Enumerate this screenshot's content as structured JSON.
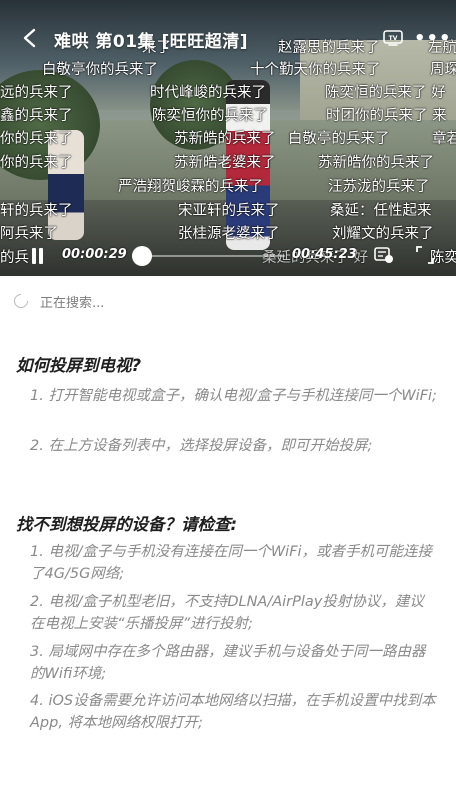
{
  "player": {
    "title": "难哄 第01集 [旺旺超清]",
    "time_current": "00:00:29",
    "time_total": "00:45:23",
    "progress": 0.0107,
    "danmaku": [
      "来了",
      "赵露思的兵来了",
      "左航",
      "白敬亭你的兵来了",
      "十个勤天你的兵来了",
      "周琛",
      "远的兵来了",
      "时代峰峻的兵来了",
      "陈奕恒的兵来了 好",
      "鑫的兵来了",
      "陈奕恒你的兵来了",
      "时团你的兵来了 来",
      "你的兵来了",
      "苏新皓的兵来了",
      "白敬亭的兵来了",
      "章若",
      "你的兵来了",
      "苏新皓老婆来了",
      "苏新皓你的兵来了",
      "严浩翔贺峻霖的兵来了",
      "汪苏泷的兵来了",
      "轩的兵来了",
      "宋亚轩的兵来了",
      "桑延：任性起来",
      "阿兵来了",
      "张桂源老婆来了",
      "刘耀文的兵来了",
      "的兵",
      "桑延的兵来了 好",
      "陈奕"
    ]
  },
  "cast": {
    "searching_label": "正在搜索...",
    "how_to_title": "如何投屏到电视?",
    "how_to_steps": [
      "1. 打开智能电视或盒子，确认电视/盒子与手机连接同一个WiFi;",
      "2. 在上方设备列表中，选择投屏设备，即可开始投屏;"
    ],
    "troubleshoot_title": "找不到想投屏的设备？请检查:",
    "troubleshoot_steps": [
      "1. 电视/盒子与手机没有连接在同一个WiFi，或者手机可能连接了4G/5G网络;",
      "2. 电视/盒子机型老旧，不支持DLNA/AirPlay投射协议，建议在电视上安装“乐播投屏”进行投射;",
      "3. 局域网中存在多个路由器，建议手机与设备处于同一路由器的Wifi环境;",
      "4. iOS设备需要允许访问本地网络以扫描，在手机设置中找到本App, 将本地网络权限打开;"
    ]
  },
  "icons": {
    "back": "chevron-left-icon",
    "tv": "tv-icon",
    "more": "more-icon",
    "pause": "pause-icon",
    "danmaku": "danmaku-toggle-icon",
    "fullscreen": "fullscreen-icon",
    "spinner": "spinner-icon"
  },
  "colors": {
    "heading": "#1f1f1f",
    "body": "#8a8a8a",
    "searching": "#7d7d7d"
  }
}
